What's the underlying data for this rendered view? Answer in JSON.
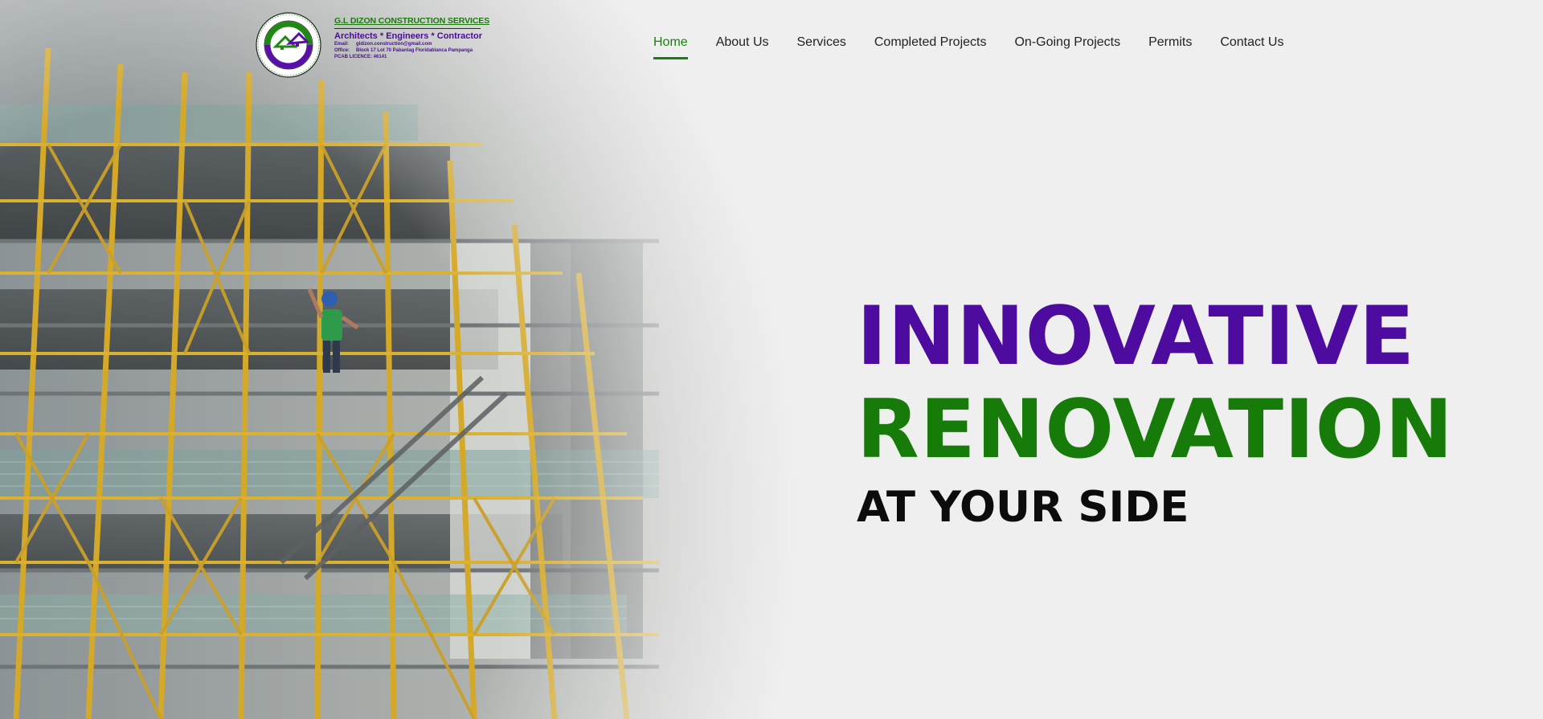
{
  "brand": {
    "company_name": "G.L DIZON CONSTRUCTION SERVICES",
    "tagline": "Architects * Engineers * Contractor",
    "email_label": "Email:",
    "email_value": "gldizon.construction@gmail.com",
    "office_label": "Office:",
    "office_value": "Block 17 Lot 70 Pabanlag  Floridablanca Pampanga",
    "license": "PCAB LICENCE: 46141",
    "seal_text_top": "G.L DIZON CONSTRUCTION SERVICES",
    "seal_text_bottom": "Architectural * Engineering * Contractor"
  },
  "nav": {
    "items": [
      {
        "label": "Home",
        "active": true
      },
      {
        "label": "About Us",
        "active": false
      },
      {
        "label": "Services",
        "active": false
      },
      {
        "label": "Completed Projects",
        "active": false
      },
      {
        "label": "On-Going Projects",
        "active": false
      },
      {
        "label": "Permits",
        "active": false
      },
      {
        "label": "Contact Us",
        "active": false
      }
    ]
  },
  "hero": {
    "line1": "INNOVATIVE",
    "line2": "RENOVATION",
    "line3": "AT YOUR SIDE"
  },
  "colors": {
    "purple": "#4e0b9f",
    "green": "#177b0a",
    "background": "#efefef",
    "scaffold_yellow": "#d4a828"
  }
}
